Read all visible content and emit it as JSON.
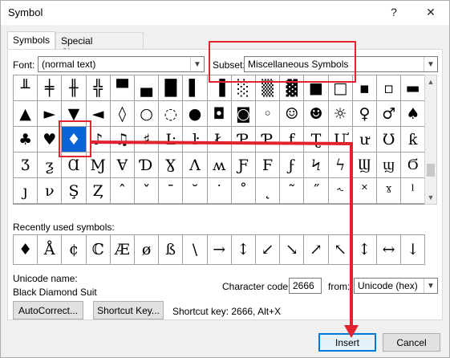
{
  "window": {
    "title": "Symbol",
    "help": "?",
    "close": "✕"
  },
  "tabs": [
    {
      "label": "Symbols"
    },
    {
      "label": "Special Characters"
    }
  ],
  "font": {
    "label": "Font:",
    "value": "(normal text)"
  },
  "subset": {
    "label": "Subset:",
    "value": "Miscellaneous Symbols"
  },
  "symbol_grid": [
    [
      "╨",
      "╪",
      "╫",
      "╬",
      "▀",
      "▄",
      "█",
      "▌",
      "▐",
      "░",
      "▒",
      "▓",
      "■",
      "□",
      "▪",
      "▫",
      "▬"
    ],
    [
      "▲",
      "►",
      "▼",
      "◄",
      "◊",
      "○",
      "◌",
      "●",
      "◘",
      "◙",
      "◦",
      "☺",
      "☻",
      "☼",
      "♀",
      "♂",
      "♠"
    ],
    [
      "♣",
      "♥",
      "♦",
      "♪",
      "♫",
      "♯",
      "Ŀ",
      "ŀ",
      "Ł",
      "Ƥ",
      "Ƥ",
      "ƭ",
      "Ʈ",
      "Ư",
      "ư",
      "Ʊ",
      "ƙ"
    ],
    [
      "Ʒ",
      "ƺ",
      "Ɑ",
      "Ɱ",
      "Ɐ",
      "Ɗ",
      "Ɣ",
      "Ʌ",
      "ʍ",
      "Ƒ",
      "Ϝ",
      "ϝ",
      "Ϟ",
      "ϟ",
      "Ϣ",
      "ϣ",
      "Ϭ"
    ],
    [
      "ȷ",
      "ν",
      "Ş",
      "Ȥ",
      "ˆ",
      "ˇ",
      "ˉ",
      "˘",
      "˙",
      "˚",
      "˛",
      "˜",
      "˝",
      "˞",
      "˟",
      "ˠ",
      "ˡ"
    ]
  ],
  "recent": {
    "label": "Recently used symbols:",
    "items": [
      "♦",
      "Å",
      "¢",
      "ℂ",
      "Æ",
      "ø",
      "ß",
      "\\",
      "→",
      "↕",
      "↙",
      "↘",
      "↗",
      "↖",
      "↕",
      "↔",
      "↓"
    ]
  },
  "unicode_name": {
    "label": "Unicode name:",
    "value": "Black Diamond Suit"
  },
  "character_code": {
    "label": "Character code:",
    "value": "2666"
  },
  "from": {
    "label": "from:",
    "value": "Unicode (hex)"
  },
  "buttons": {
    "autocorrect": "AutoCorrect...",
    "shortcut_key": "Shortcut Key...",
    "insert": "Insert",
    "cancel": "Cancel"
  },
  "shortcut_text": "Shortcut key: 2666, Alt+X",
  "colors": {
    "highlight": "#e0232e",
    "selection": "#0a64d8"
  }
}
